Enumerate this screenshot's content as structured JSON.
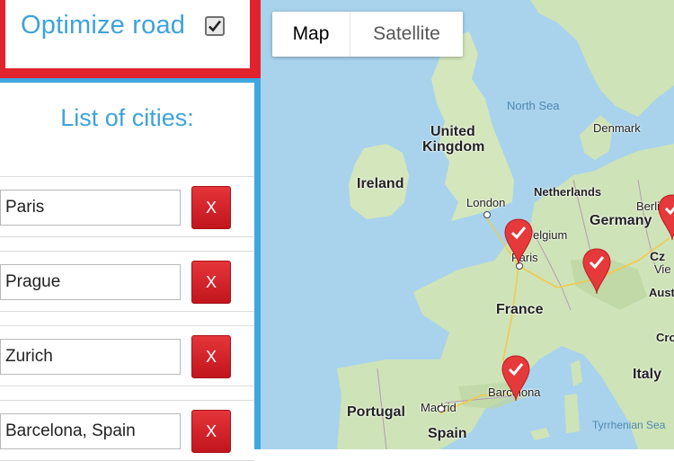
{
  "optimize": {
    "label": "Optimize road",
    "checked": true
  },
  "list": {
    "title": "List of cities:",
    "cities": [
      {
        "value": "Paris",
        "remove_label": "X"
      },
      {
        "value": "Prague",
        "remove_label": "X"
      },
      {
        "value": "Zurich",
        "remove_label": "X"
      },
      {
        "value": "Barcelona, Spain",
        "remove_label": "X"
      }
    ]
  },
  "map": {
    "type_buttons": {
      "map": "Map",
      "satellite": "Satellite"
    },
    "selected_type": "Map",
    "labels": {
      "north_sea": "North Sea",
      "united_kingdom_1": "United",
      "united_kingdom_2": "Kingdom",
      "denmark": "Denmark",
      "ireland": "Ireland",
      "netherlands": "Netherlands",
      "london": "London",
      "berlin": "Berlin",
      "germany": "Germany",
      "belgium": "elgium",
      "paris": "Paris",
      "czechia": "Cz",
      "vienna": "Vie",
      "austria": "Aust",
      "france": "France",
      "croatia": "Cro",
      "italy": "Italy",
      "portugal": "Portugal",
      "madrid": "Madrid",
      "barcelona": "Barcelona",
      "spain": "Spain",
      "tyrrhenian": "Tyrrhenian Sea"
    },
    "colors": {
      "water": "#a9d3ec",
      "land": "#cfe3b8",
      "marker": "#e5393b"
    },
    "marker_icon": "checkmark-marker-icon"
  }
}
